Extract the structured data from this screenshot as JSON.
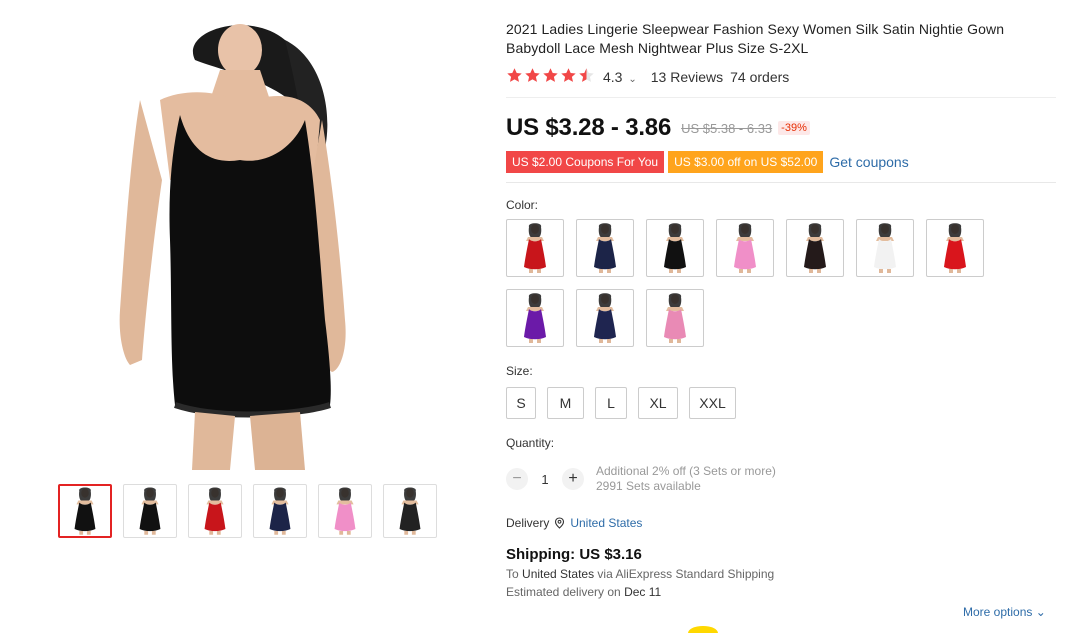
{
  "product": {
    "title": "2021 Ladies Lingerie Sleepwear Fashion Sexy Women Silk Satin Nightie Gown Babydoll Lace Mesh Nightwear Plus Size S-2XL",
    "rating": "4.3",
    "rating_caret": "⌄",
    "reviews": "13 Reviews",
    "orders": "74 orders",
    "stars_filled": 4.5,
    "star_color": "#f14747",
    "price": "US $3.28 - 3.86",
    "original_price": "US $5.38 - 6.33",
    "discount": "-39%"
  },
  "coupons": {
    "coupon1": "US $2.00 Coupons For You",
    "coupon2": "US $3.00 off on US $52.00",
    "get_coupons": "Get coupons"
  },
  "color": {
    "label": "Color:",
    "swatches": [
      "#c8151b",
      "#1c2448",
      "#111111",
      "#f08fc8",
      "#241a1a",
      "#f2f2f2",
      "#d9151c",
      "#6b1aa8",
      "#1f2550",
      "#e98ab5"
    ]
  },
  "size": {
    "label": "Size:",
    "options": [
      "S",
      "M",
      "L",
      "XL",
      "XXL"
    ]
  },
  "quantity": {
    "label": "Quantity:",
    "minus": "−",
    "value": "1",
    "plus": "+",
    "note1": "Additional 2% off (3 Sets or more)",
    "note2": "2991 Sets available"
  },
  "delivery": {
    "label": "Delivery",
    "country": "United States",
    "shipping": "Shipping: US $3.16",
    "to_prefix": "To",
    "to_country": "United States",
    "via_prefix": "via",
    "carrier": "AliExpress Standard Shipping",
    "estimated_prefix": "Estimated delivery on",
    "estimated_date": "Dec 11",
    "more_options": "More options",
    "more_caret": "⌄"
  },
  "gallery": {
    "thumb_colors": [
      "#111111",
      "#111111",
      "#c8151b",
      "#1c2448",
      "#f08fc8",
      "#222222"
    ],
    "active_index": 0,
    "active_color": "#e32323"
  },
  "icons": {
    "location": "location-pin-icon",
    "star": "star-icon",
    "chevron": "chevron-down-icon"
  }
}
